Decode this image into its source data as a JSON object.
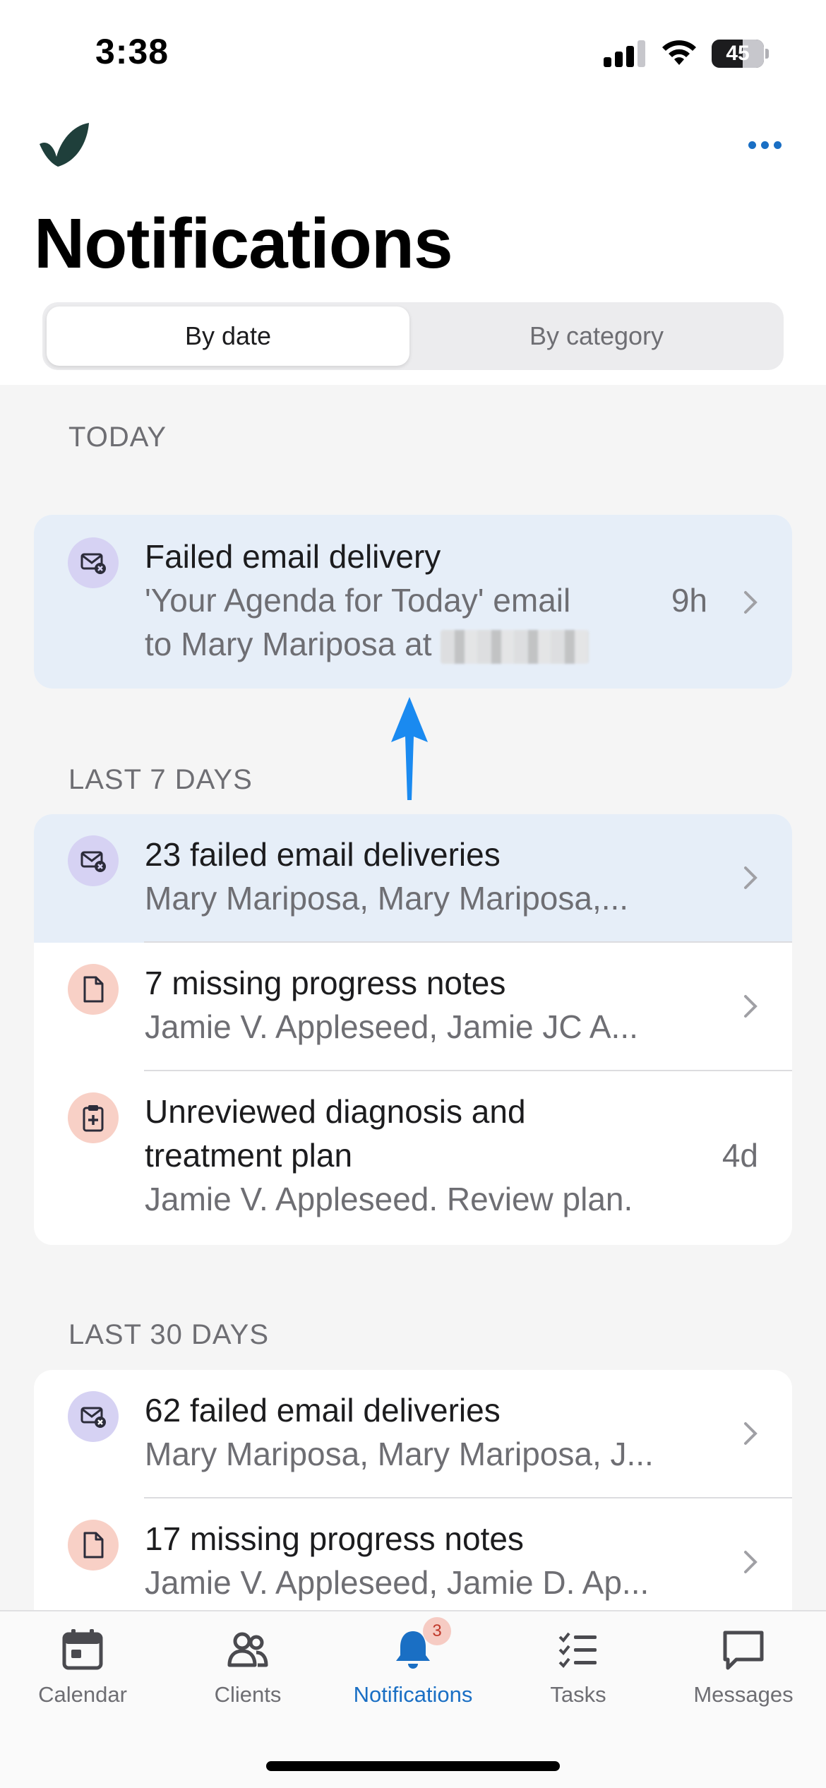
{
  "status_bar": {
    "time": "3:38",
    "battery": "45",
    "battery_level": 0.45
  },
  "header": {
    "title": "Notifications"
  },
  "segmented": {
    "by_date": "By date",
    "by_category": "By category",
    "selected": "By date"
  },
  "sections": {
    "today": {
      "label": "TODAY",
      "items": [
        {
          "title": "Failed email delivery",
          "line1": "'Your Agenda for Today' email",
          "line2": "to Mary Mariposa at",
          "time": "9h",
          "icon": "email-error-icon"
        }
      ]
    },
    "last7": {
      "label": "LAST 7 DAYS",
      "items": [
        {
          "title": "23 failed email deliveries",
          "sub": "Mary Mariposa, Mary Mariposa,...",
          "icon": "email-error-icon"
        },
        {
          "title": "7 missing progress notes",
          "sub": "Jamie V. Appleseed, Jamie JC A...",
          "icon": "document-icon"
        },
        {
          "title1": "Unreviewed diagnosis and",
          "title2": "treatment plan",
          "sub": "Jamie V. Appleseed. Review plan.",
          "time": "4d",
          "icon": "clipboard-plus-icon"
        }
      ]
    },
    "last30": {
      "label": "LAST 30 DAYS",
      "items": [
        {
          "title": "62 failed email deliveries",
          "sub": "Mary Mariposa, Mary Mariposa, J...",
          "icon": "email-error-icon"
        },
        {
          "title": "17 missing progress notes",
          "sub": "Jamie V. Appleseed, Jamie D. Ap...",
          "icon": "document-icon"
        }
      ]
    }
  },
  "tabs": [
    {
      "label": "Calendar",
      "icon": "calendar-icon"
    },
    {
      "label": "Clients",
      "icon": "clients-icon"
    },
    {
      "label": "Notifications",
      "icon": "bell-icon",
      "badge": "3",
      "active": true
    },
    {
      "label": "Tasks",
      "icon": "tasks-icon"
    },
    {
      "label": "Messages",
      "icon": "message-icon"
    }
  ],
  "colors": {
    "accent": "#1a6fc4",
    "highlight": "#e6eef8",
    "purple_icon_bg": "#d6d2f3",
    "salmon_icon_bg": "#f8d0c6"
  }
}
